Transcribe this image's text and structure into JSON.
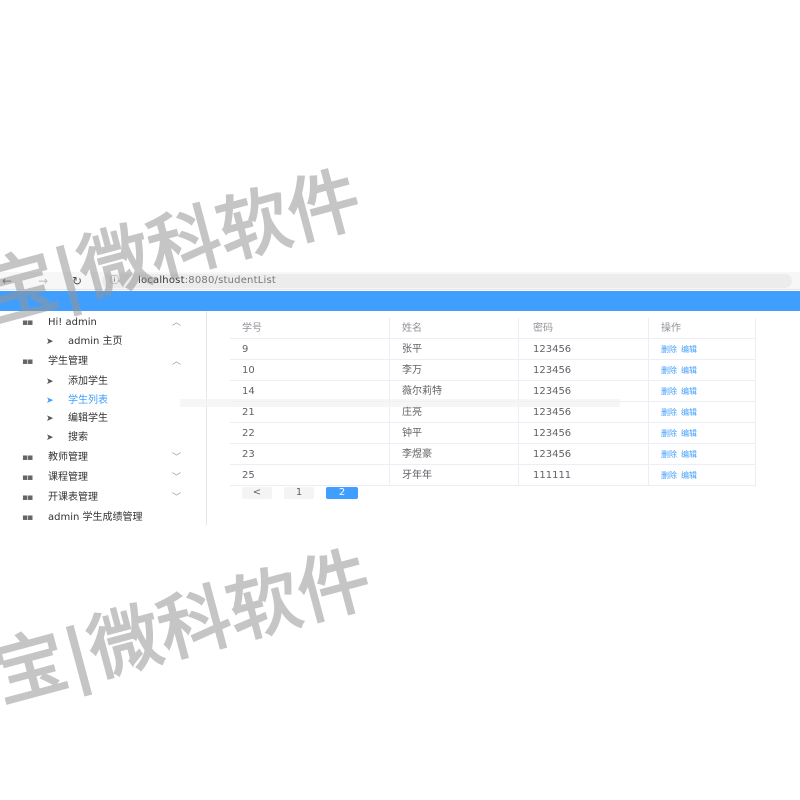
{
  "browser": {
    "back_icon": "arrow-left-icon",
    "forward_icon": "arrow-right-icon",
    "reload_icon": "reload-icon",
    "info_icon": "info-icon",
    "url_host": "localhost",
    "url_path": ":8080/studentList"
  },
  "sidebar": {
    "greeting": "Hi! admin",
    "home": "admin 主页",
    "student_mgmt": "学生管理",
    "add_student": "添加学生",
    "student_list": "学生列表",
    "edit_student": "编辑学生",
    "search": "搜索",
    "teacher_mgmt": "教师管理",
    "course_mgmt": "课程管理",
    "open_course_mgmt": "开课表管理",
    "score_mgmt": "admin 学生成绩管理"
  },
  "table": {
    "headers": [
      "学号",
      "姓名",
      "密码",
      "操作"
    ],
    "rows": [
      [
        "9",
        "张平",
        "123456"
      ],
      [
        "10",
        "李万",
        "123456"
      ],
      [
        "14",
        "薇尔莉特",
        "123456"
      ],
      [
        "21",
        "庄亮",
        "123456"
      ],
      [
        "22",
        "钟平",
        "123456"
      ],
      [
        "23",
        "李煜豪",
        "123456"
      ],
      [
        "25",
        "牙年年",
        "111111"
      ]
    ],
    "delete_label": "删除",
    "edit_label": "编辑"
  },
  "pagination": {
    "prev": "<",
    "pages": [
      "1",
      "2"
    ],
    "current": "2"
  },
  "watermark": "宝|微科软件",
  "colors": {
    "header": "#409eff",
    "accent": "#409eff"
  }
}
